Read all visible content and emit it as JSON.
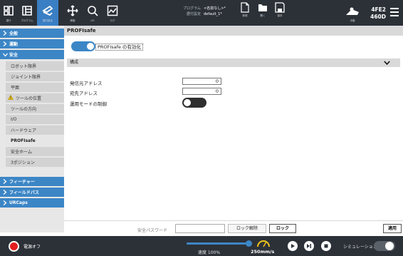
{
  "topbar": {
    "buttons": [
      {
        "name": "run",
        "label": "運行"
      },
      {
        "name": "program",
        "label": "プログラム"
      },
      {
        "name": "installation",
        "label": "据付設定"
      },
      {
        "name": "move",
        "label": "移動"
      },
      {
        "name": "io",
        "label": "I/O"
      },
      {
        "name": "log",
        "label": "ログ"
      }
    ],
    "program_label": "プログラム",
    "program_value": "<名前なし>*",
    "installation_label": "据付設定",
    "installation_value": "default_1*",
    "file_ops": [
      {
        "name": "new",
        "label": "新規"
      },
      {
        "name": "open",
        "label": "開く"
      },
      {
        "name": "save",
        "label": "保存"
      }
    ],
    "robot_label": "手動",
    "serial_line1": "4FE2",
    "serial_line2": "460D"
  },
  "sidebar": {
    "general": "全般",
    "motion": "運動",
    "safety": "安全",
    "safety_items": [
      "ロボット限界",
      "ジョイント限界",
      "平面",
      "ツールの位置",
      "ツールの方向",
      "I/O",
      "ハードウェア",
      "PROFIsafe",
      "安全ホーム",
      "3ポジション"
    ],
    "features": "フィーチャー",
    "fieldbus": "フィールドバス",
    "urcaps": "URCaps"
  },
  "main": {
    "title": "PROFIsafe",
    "enable_label": "PROFIsafe の有効化",
    "config_header": "構成",
    "source_address_label": "発信元アドレス",
    "source_address_value": "0",
    "target_address_label": "宛先アドレス",
    "target_address_value": "0",
    "operating_mode_label": "運用モードの制御",
    "password_label": "安全パスワード",
    "unlock_label": "ロック解除",
    "lock_label": "ロック",
    "apply_label": "適用"
  },
  "footer": {
    "power_label": "電源オフ",
    "speed_label": "速度 100%",
    "speed_fraction": 1.0,
    "tool_speed": "250mm/s",
    "simulation_label": "シミュレーション"
  },
  "colors": {
    "accent": "#3c86c6",
    "topbar": "#2c3138",
    "power": "#e31d1d"
  }
}
